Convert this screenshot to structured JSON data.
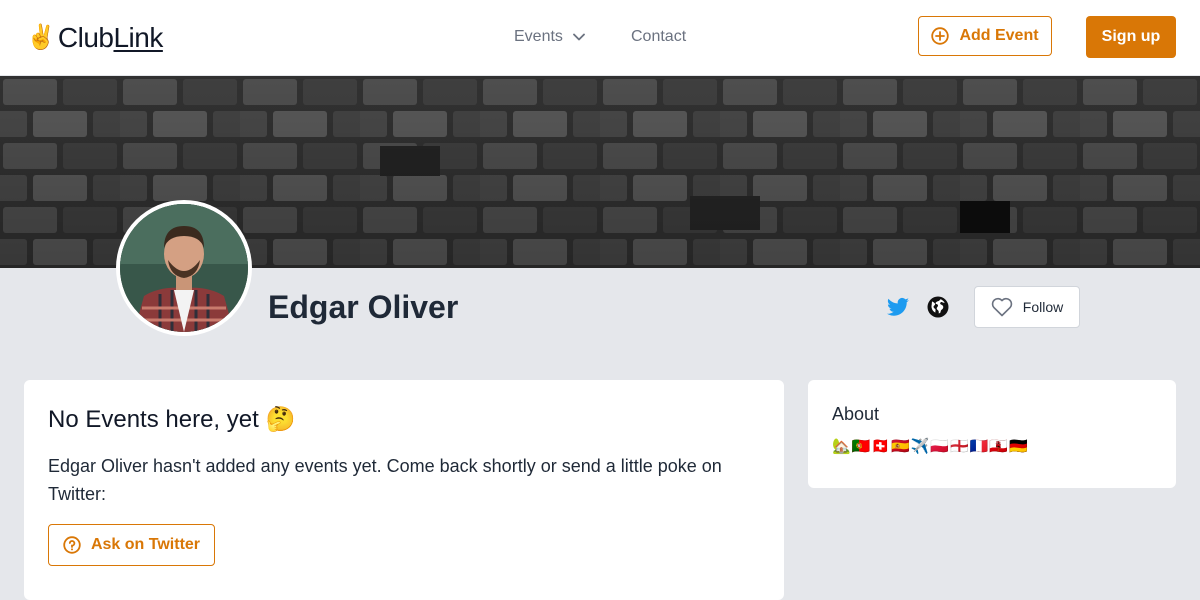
{
  "header": {
    "logo": {
      "icon": "victory-hand-emoji",
      "hand": "✌️",
      "text_part1": "Club",
      "text_part2": "Link"
    },
    "nav": {
      "events_label": "Events",
      "contact_label": "Contact"
    },
    "add_event_label": "Add Event",
    "signup_label": "Sign up"
  },
  "profile": {
    "name": "Edgar Oliver",
    "icons": [
      "twitter-icon",
      "globe-icon"
    ],
    "follow_label": "Follow"
  },
  "events_card": {
    "title": "No Events here, yet 🤔",
    "description": "Edgar Oliver hasn't added any events yet. Come back shortly or send a little poke on Twitter:",
    "ask_button_label": "Ask on Twitter"
  },
  "about_card": {
    "title": "About",
    "bio": "🏡🇵🇹🇨🇭🇪🇸✈️🇵🇱🏴󠁧󠁢󠁥󠁮󠁧󠁿🇫🇷🇬🇮🇩🇪"
  },
  "colors": {
    "accent": "#d97706",
    "twitter": "#1d9bf0",
    "page_bg": "#e5e7eb"
  }
}
